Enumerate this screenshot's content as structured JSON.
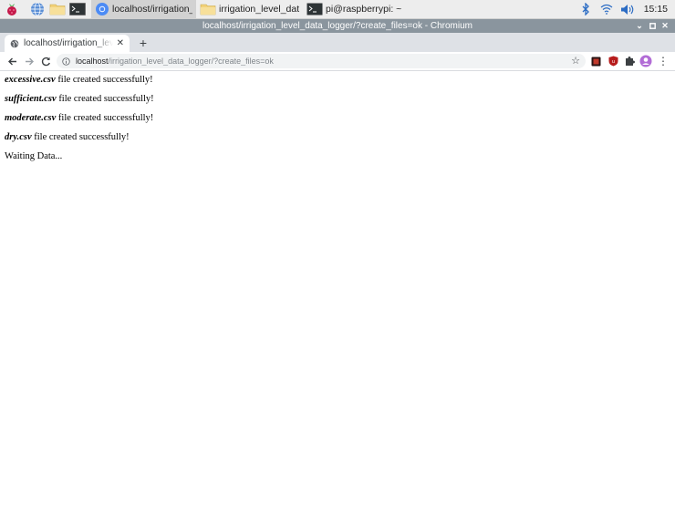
{
  "taskbar": {
    "tasks": [
      {
        "label": "localhost/irrigation_le..."
      },
      {
        "label": "irrigation_level_data_l..."
      },
      {
        "label": "pi@raspberrypi: ~"
      }
    ],
    "clock": "15:15"
  },
  "window": {
    "title": "localhost/irrigation_level_data_logger/?create_files=ok - Chromium"
  },
  "browser": {
    "tab_title": "localhost/irrigation_level_data_logger",
    "url_host": "localhost",
    "url_path": "/irrigation_level_data_logger/?create_files=ok"
  },
  "page": {
    "messages": [
      {
        "file": "excessive.csv",
        "text": " file created successfully!"
      },
      {
        "file": "sufficient.csv",
        "text": " file created successfully!"
      },
      {
        "file": "moderate.csv",
        "text": " file created successfully!"
      },
      {
        "file": "dry.csv",
        "text": " file created successfully!"
      }
    ],
    "status": "Waiting Data..."
  },
  "colors": {
    "taskbar_bg": "#ededed",
    "titlebar_bg": "#8a959e",
    "tabstrip_bg": "#dee1e6",
    "omnibox_bg": "#f1f3f4"
  }
}
